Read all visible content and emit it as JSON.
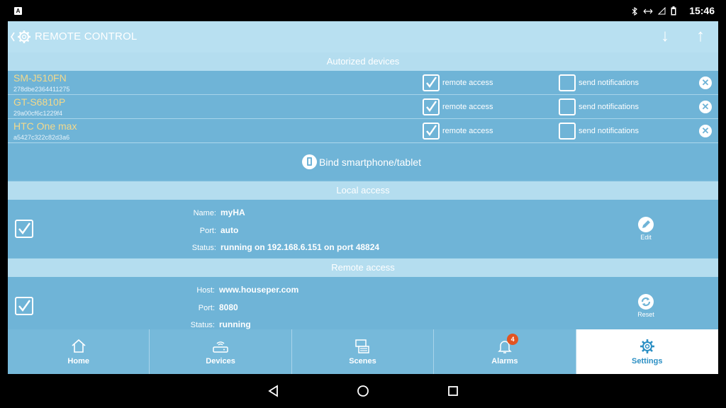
{
  "status_bar": {
    "time": "15:46",
    "notification_icon": "a-icon",
    "icons": [
      "bluetooth-icon",
      "data-sync-icon",
      "signal-icon",
      "battery-icon"
    ]
  },
  "header": {
    "title": "REMOTE CONTROL",
    "back_icon": "gear-back-icon",
    "down_arrow": "↓",
    "up_arrow": "↑"
  },
  "authorized": {
    "title": "Autorized devices",
    "remote_access_label": "remote access",
    "send_notifications_label": "send notifications",
    "devices": [
      {
        "name": "SM-J510FN",
        "id": "278dbe2364411275",
        "remote_access": true,
        "send_notifications": false
      },
      {
        "name": "GT-S6810P",
        "id": "29a00cf6c1229f4",
        "remote_access": true,
        "send_notifications": false
      },
      {
        "name": "HTC One max",
        "id": "a5427c322c82d3a6",
        "remote_access": true,
        "send_notifications": false
      }
    ]
  },
  "bind": {
    "label": "Bind smartphone/tablet"
  },
  "local_access": {
    "title": "Local access",
    "enabled": true,
    "name_label": "Name:",
    "name_value": "myHA",
    "port_label": "Port:",
    "port_value": "auto",
    "status_label": "Status:",
    "status_value": "running on 192.168.6.151 on port 48824",
    "action_label": "Edit"
  },
  "remote_access": {
    "title": "Remote access",
    "enabled": true,
    "host_label": "Host:",
    "host_value": "www.houseper.com",
    "port_label": "Port:",
    "port_value": "8080",
    "status_label": "Status:",
    "status_value": "running",
    "action_label": "Reset"
  },
  "nav": {
    "items": [
      {
        "label": "Home",
        "icon": "home-icon"
      },
      {
        "label": "Devices",
        "icon": "router-icon"
      },
      {
        "label": "Scenes",
        "icon": "scenes-icon"
      },
      {
        "label": "Alarms",
        "icon": "bell-icon",
        "badge": "4"
      },
      {
        "label": "Settings",
        "icon": "gear-icon",
        "active": true
      }
    ]
  },
  "colors": {
    "background": "#76b9da",
    "header": "#b8e0f1",
    "device_name": "#f3d98b",
    "active_nav_text": "#2b8fc4",
    "badge": "#e25522"
  }
}
